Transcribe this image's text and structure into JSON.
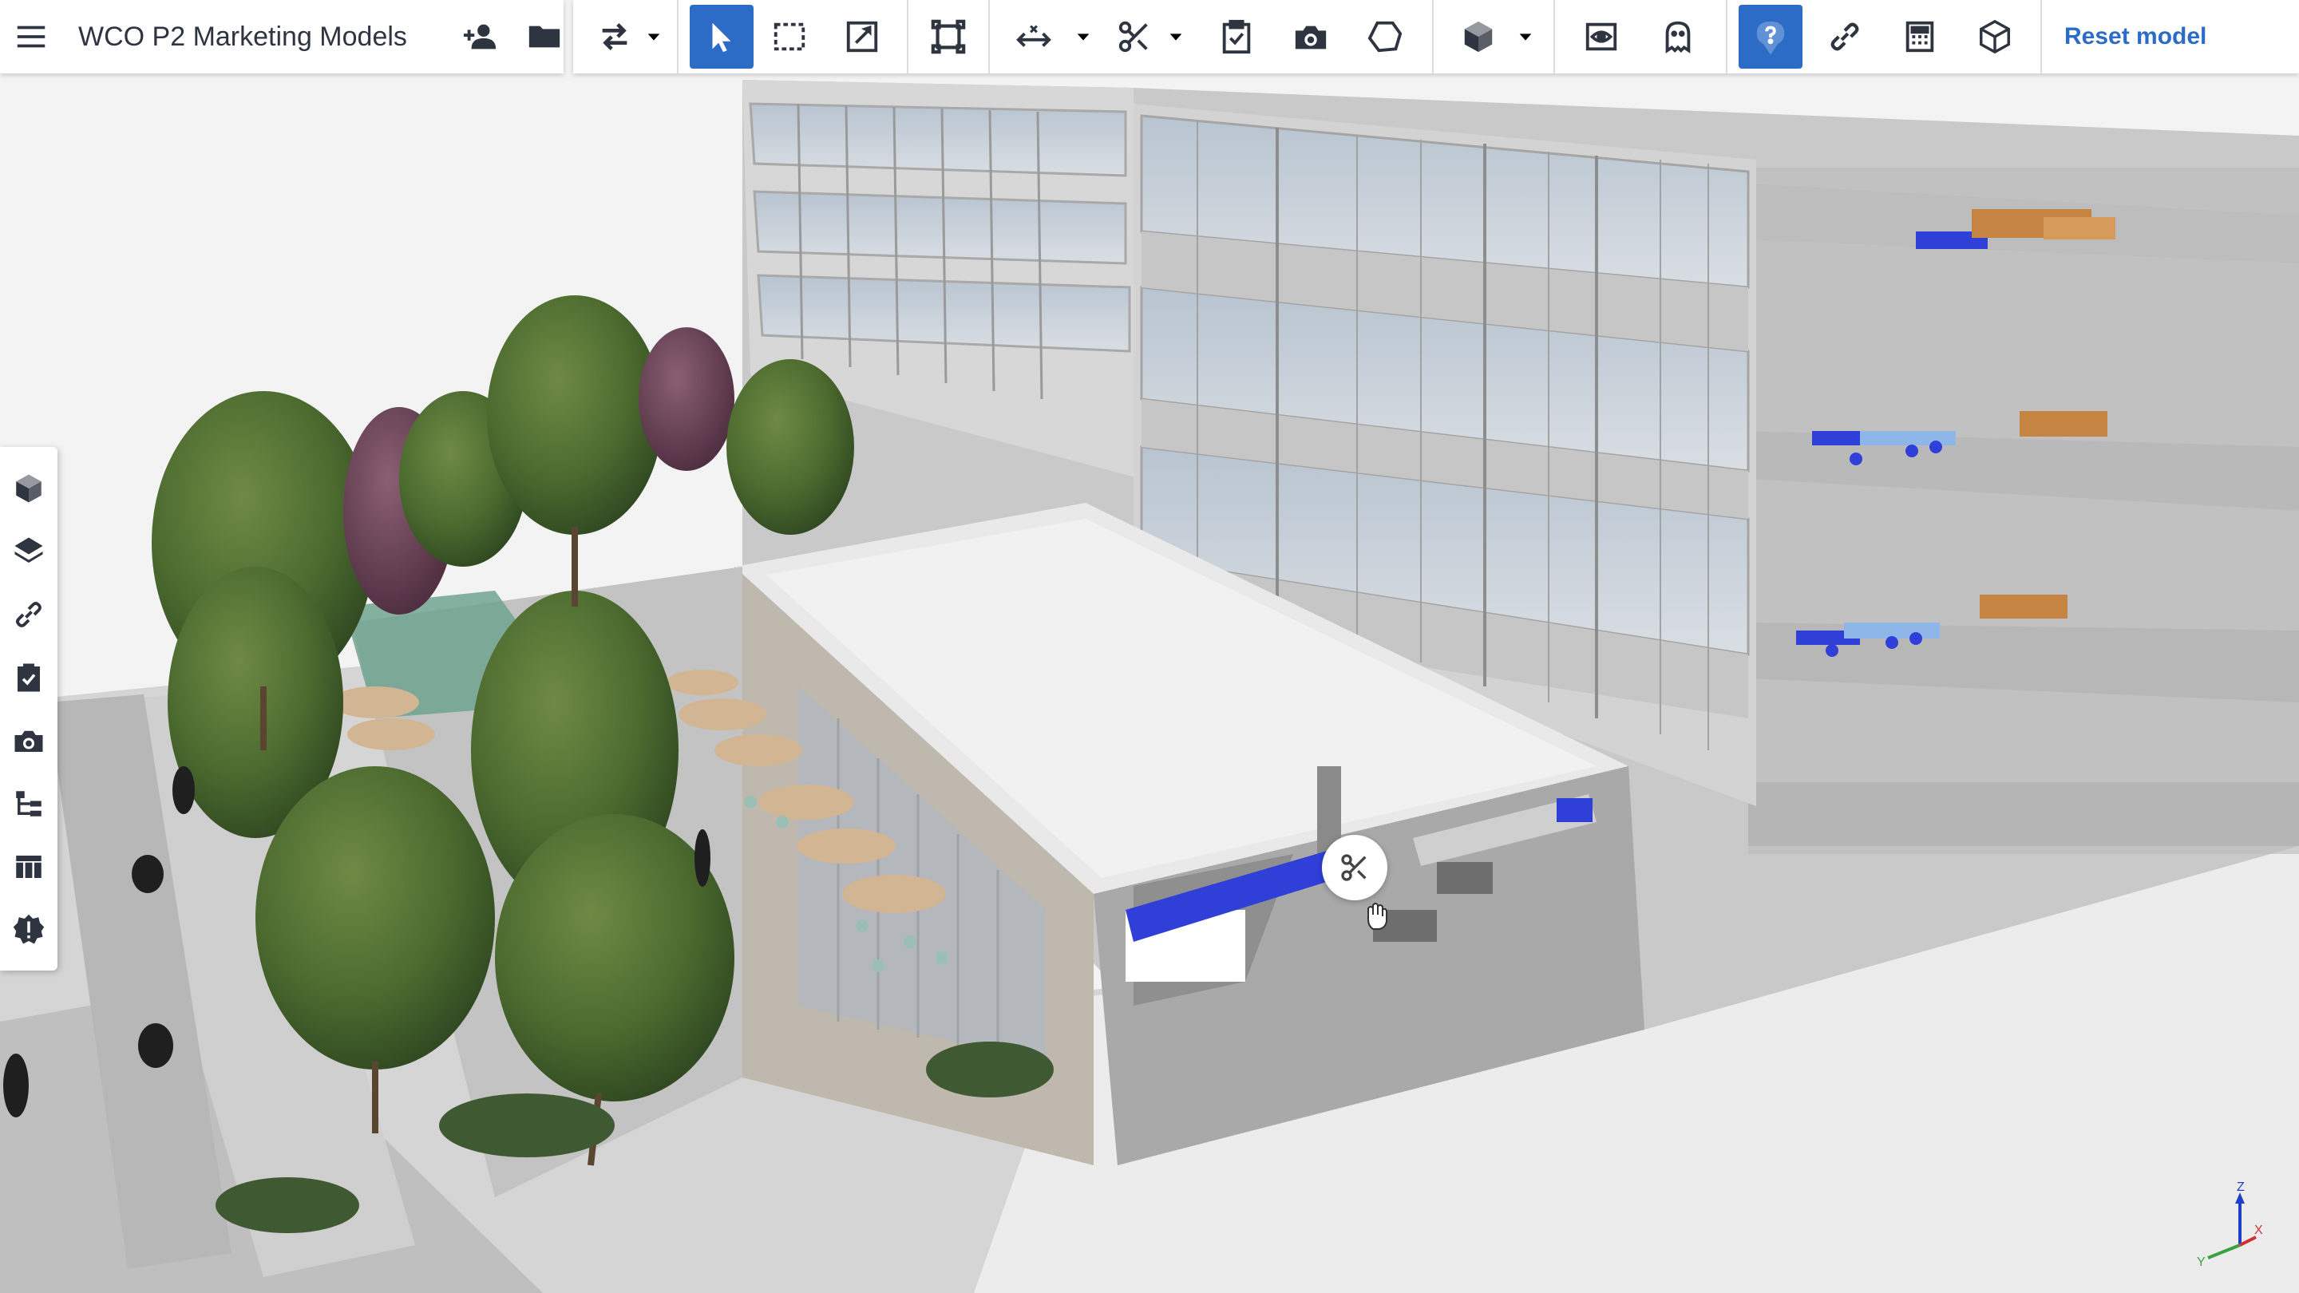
{
  "app": {
    "title": "WCO P2 Marketing Models"
  },
  "toolbar": {
    "left_icons": [
      "menu-icon",
      "add-user-icon",
      "folder-icon"
    ],
    "tools": [
      {
        "name": "transfer-tool",
        "icon": "swap-arrows-icon",
        "dropdown": true
      },
      {
        "name": "select-tool",
        "icon": "cursor-arrow-icon",
        "active": true
      },
      {
        "name": "box-select-tool",
        "icon": "dashed-rectangle-icon"
      },
      {
        "name": "markup-tool",
        "icon": "edit-square-icon"
      },
      {
        "name": "fit-view-tool",
        "icon": "frame-fit-icon"
      },
      {
        "name": "measure-tool",
        "icon": "measure-icon",
        "dropdown": true
      },
      {
        "name": "section-tool",
        "icon": "scissors-icon",
        "dropdown": true
      },
      {
        "name": "create-issue-tool",
        "icon": "clipboard-check-icon"
      },
      {
        "name": "snapshot-tool",
        "icon": "camera-plus-icon"
      },
      {
        "name": "freeform-tool",
        "icon": "blob-shape-icon"
      },
      {
        "name": "render-mode-tool",
        "icon": "cube-icon",
        "dropdown": true
      },
      {
        "name": "visibility-tool",
        "icon": "eye-frame-icon"
      },
      {
        "name": "ghost-tool",
        "icon": "ghost-icon"
      },
      {
        "name": "help-tool",
        "icon": "question-bubble-icon",
        "active": true
      },
      {
        "name": "link-tool",
        "icon": "link-icon"
      },
      {
        "name": "calculator-tool",
        "icon": "calculator-icon"
      },
      {
        "name": "box-tool",
        "icon": "box-outline-icon"
      }
    ],
    "reset_label": "Reset model"
  },
  "side_toolbar": {
    "items": [
      {
        "name": "side-objects",
        "icon": "cube-icon"
      },
      {
        "name": "side-layers",
        "icon": "layers-icon"
      },
      {
        "name": "side-links",
        "icon": "link-icon"
      },
      {
        "name": "side-tasks",
        "icon": "clipboard-check-icon"
      },
      {
        "name": "side-views",
        "icon": "camera-icon"
      },
      {
        "name": "side-tree",
        "icon": "tree-hierarchy-icon"
      },
      {
        "name": "side-table",
        "icon": "table-icon"
      },
      {
        "name": "side-clash",
        "icon": "alert-badge-icon"
      }
    ]
  },
  "viewport": {
    "cursor_icon": "hand-cursor-icon",
    "section_badge_icon": "scissors-icon",
    "axes": {
      "z": "Z",
      "x": "X",
      "y": "Y"
    }
  },
  "colors": {
    "accent": "#2c6cc7",
    "toolbar_bg": "#ffffff",
    "icon": "#2e3440",
    "duct_blue": "#2f3fd8"
  }
}
